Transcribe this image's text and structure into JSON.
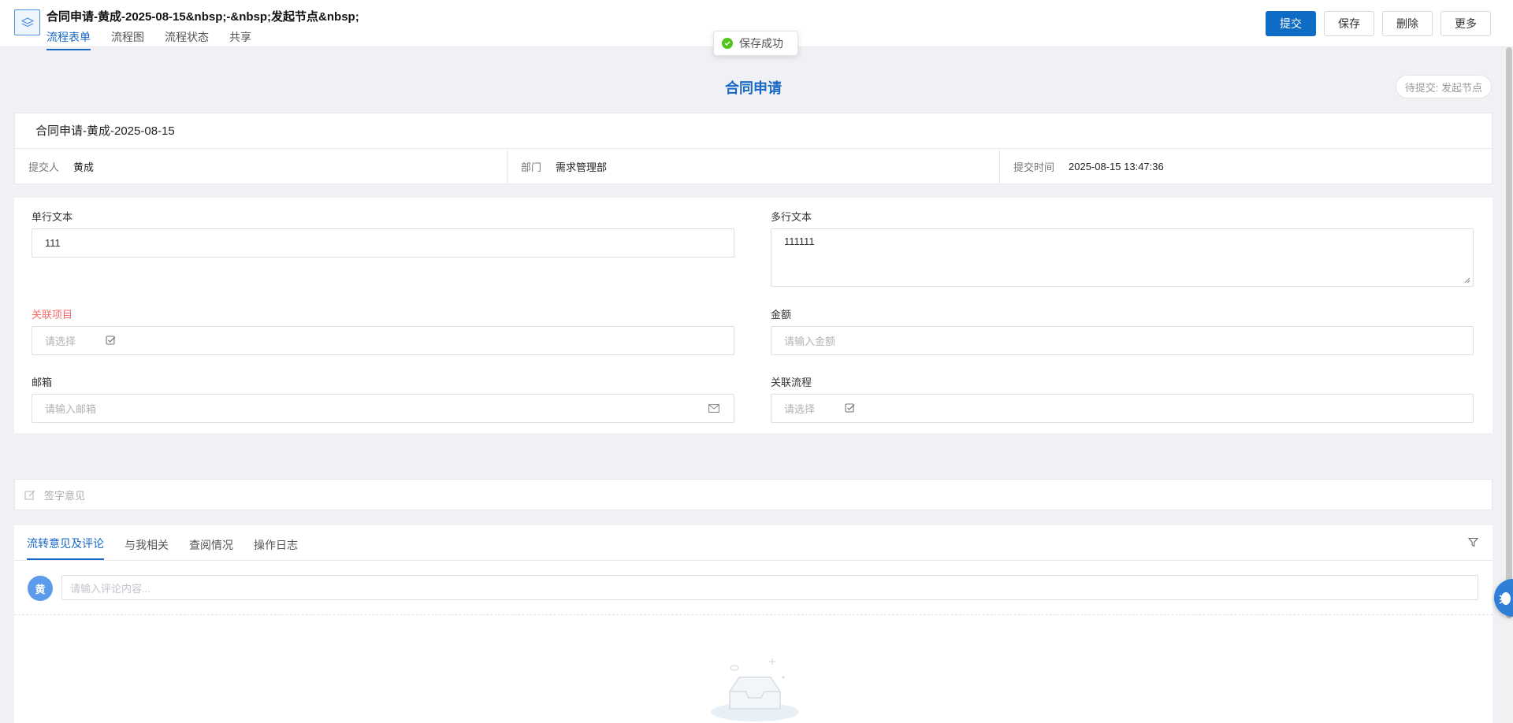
{
  "header": {
    "title": "合同申请-黄成-2025-08-15&nbsp;-&nbsp;发起节点&nbsp;",
    "tabs": [
      "流程表单",
      "流程图",
      "流程状态",
      "共享"
    ],
    "actions": {
      "submit": "提交",
      "save": "保存",
      "delete": "删除",
      "more": "更多"
    }
  },
  "toast": {
    "message": "保存成功"
  },
  "form_title": "合同申请",
  "status_pill": "待提交: 发起节点",
  "info": {
    "title": "合同申请-黄成-2025-08-15",
    "submitter_label": "提交人",
    "submitter": "黄成",
    "dept_label": "部门",
    "dept": "需求管理部",
    "time_label": "提交时间",
    "time": "2025-08-15 13:47:36"
  },
  "fields": {
    "single_text": {
      "label": "单行文本",
      "value": "111"
    },
    "multi_text": {
      "label": "多行文本",
      "value": "111111"
    },
    "project": {
      "label": "关联项目",
      "placeholder": "请选择"
    },
    "amount": {
      "label": "金额",
      "placeholder": "请输入金额"
    },
    "email": {
      "label": "邮箱",
      "placeholder": "请输入邮箱"
    },
    "flow": {
      "label": "关联流程",
      "placeholder": "请选择"
    }
  },
  "sign": {
    "placeholder": "签字意见"
  },
  "comments": {
    "tabs": [
      "流转意见及评论",
      "与我相关",
      "查阅情况",
      "操作日志"
    ],
    "avatar": "黄",
    "placeholder": "请输入评论内容..."
  },
  "colors": {
    "accent": "#1869c5",
    "primary_button": "#0f6cc5",
    "required": "#f56c6c",
    "success": "#52c41a"
  }
}
